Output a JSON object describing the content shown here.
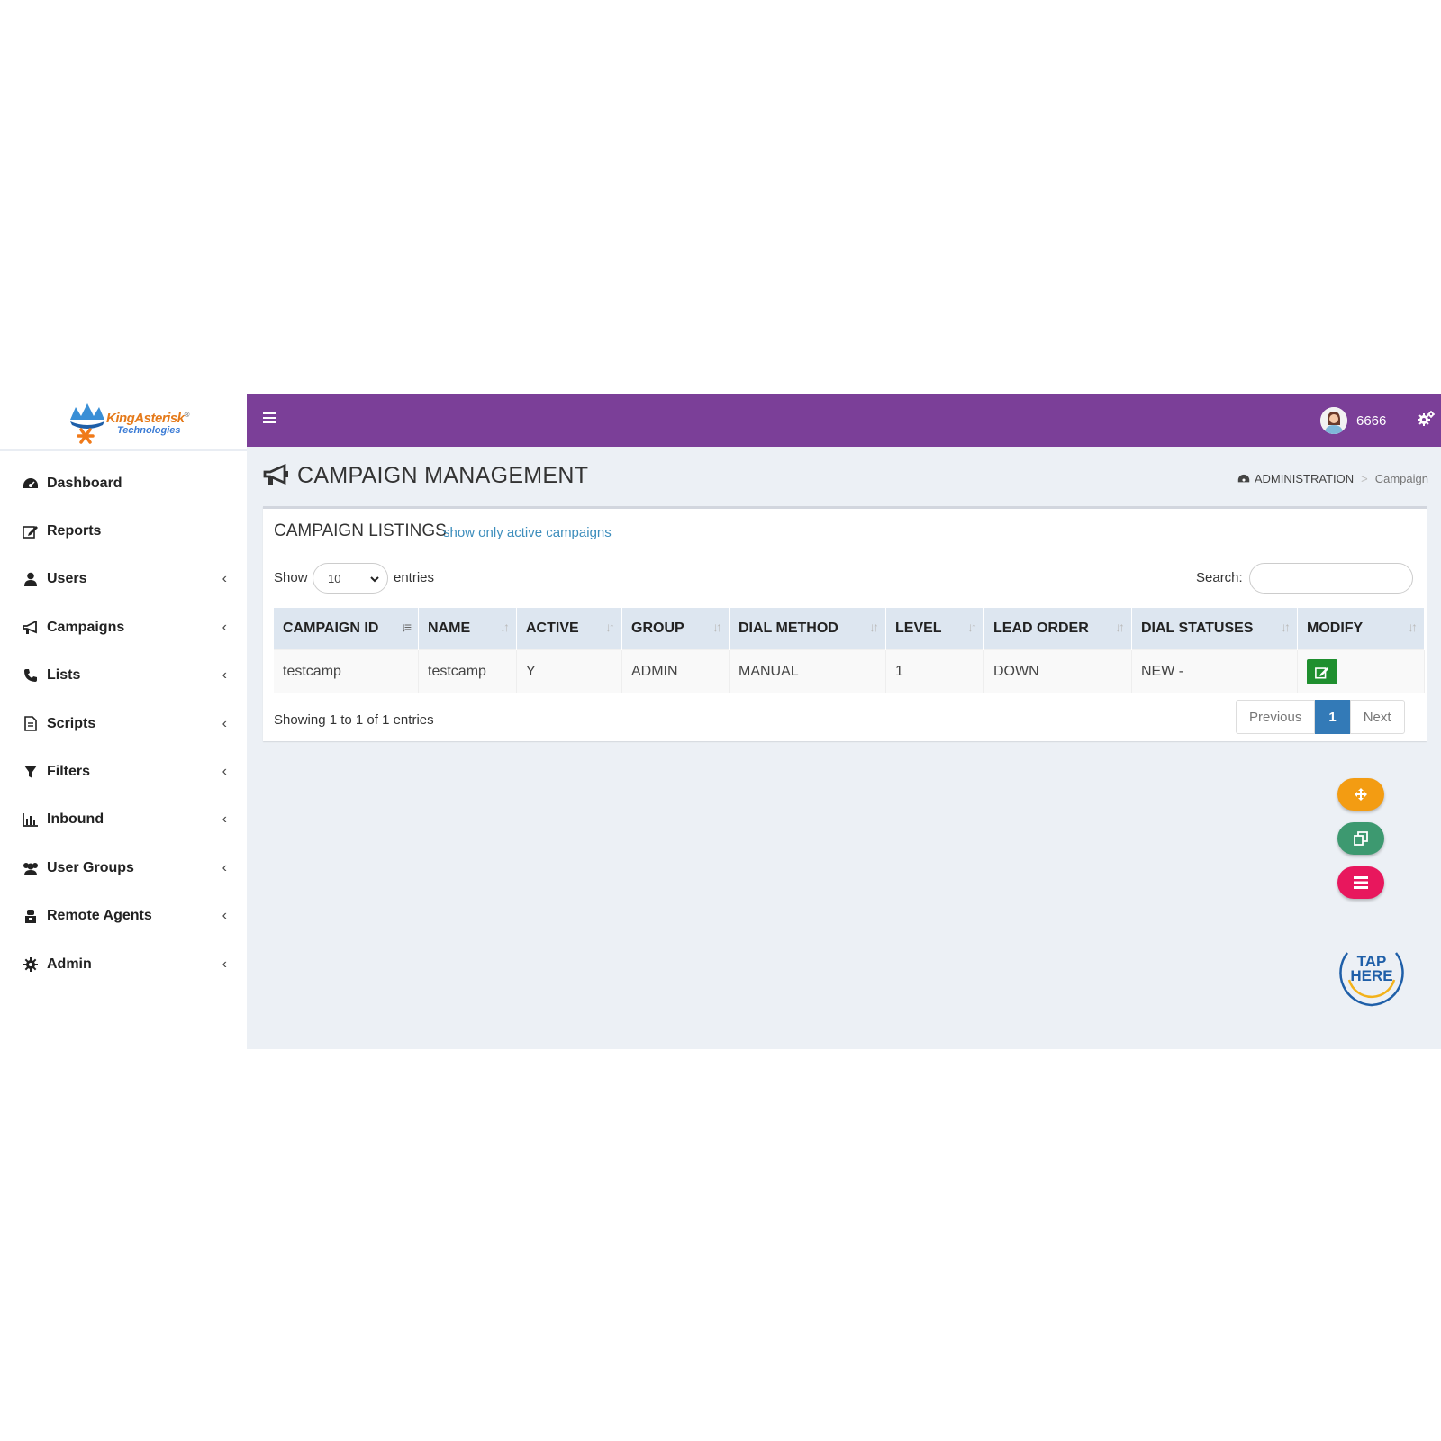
{
  "brand": {
    "logo_text": "KingAsterisk",
    "logo_sub": "Technologies",
    "logo_reg": "®"
  },
  "sidebar": {
    "items": [
      {
        "label": "Dashboard",
        "icon": "dashboard-icon",
        "has_children": false
      },
      {
        "label": "Reports",
        "icon": "edit-icon",
        "has_children": false
      },
      {
        "label": "Users",
        "icon": "user-icon",
        "has_children": true
      },
      {
        "label": "Campaigns",
        "icon": "bullhorn-icon",
        "has_children": true
      },
      {
        "label": "Lists",
        "icon": "phone-icon",
        "has_children": true
      },
      {
        "label": "Scripts",
        "icon": "file-icon",
        "has_children": true
      },
      {
        "label": "Filters",
        "icon": "filter-icon",
        "has_children": true
      },
      {
        "label": "Inbound",
        "icon": "bar-chart-icon",
        "has_children": true
      },
      {
        "label": "User Groups",
        "icon": "users-icon",
        "has_children": true
      },
      {
        "label": "Remote Agents",
        "icon": "agent-icon",
        "has_children": true
      },
      {
        "label": "Admin",
        "icon": "gear-icon",
        "has_children": true
      }
    ],
    "chevron": "‹"
  },
  "topbar": {
    "username": "6666",
    "accent": "#7b3f98"
  },
  "page": {
    "title": "CAMPAIGN MANAGEMENT"
  },
  "breadcrumb": {
    "root": "ADMINISTRATION",
    "separator": ">",
    "current": "Campaign"
  },
  "listing": {
    "title": "CAMPAIGN LISTINGS",
    "filter_link": "show only active campaigns",
    "show_label": "Show",
    "page_length": "10",
    "entries_label": "entries",
    "search_label": "Search:",
    "search_value": "",
    "columns": [
      "CAMPAIGN ID",
      "NAME",
      "ACTIVE",
      "GROUP",
      "DIAL METHOD",
      "LEVEL",
      "LEAD ORDER",
      "DIAL STATUSES",
      "MODIFY"
    ],
    "rows": [
      {
        "campaign_id": "testcamp",
        "name": "testcamp",
        "active": "Y",
        "group": "ADMIN",
        "dial_method": "MANUAL",
        "level": "1",
        "lead_order": "DOWN",
        "dial_statuses": "NEW -"
      }
    ],
    "info": "Showing 1 to 1 of 1 entries",
    "pager": {
      "previous": "Previous",
      "current": "1",
      "next": "Next"
    }
  },
  "fab": {
    "tap_line1": "TAP",
    "tap_line2": "HERE"
  }
}
